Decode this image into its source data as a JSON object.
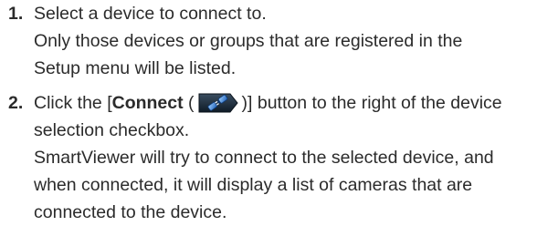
{
  "steps": [
    {
      "number": "1.",
      "lines": [
        "Select a device to connect to.",
        "Only those devices or groups that are registered in the",
        "Setup menu will be listed."
      ]
    },
    {
      "number": "2.",
      "line1_pre": "Click the [",
      "line1_bold": "Connect",
      "line1_paren_open": " (",
      "icon": "connect-plug-icon",
      "line1_post": ")] button to the right of the device",
      "lines": [
        "selection checkbox.",
        "SmartViewer will try to connect to the selected device, and",
        "when connected, it will display a list of cameras that are",
        "connected to the device."
      ]
    }
  ],
  "colors": {
    "text": "#2b2b2b",
    "icon_blue": "#1d5fb8",
    "icon_dark": "#1a2a3a"
  }
}
